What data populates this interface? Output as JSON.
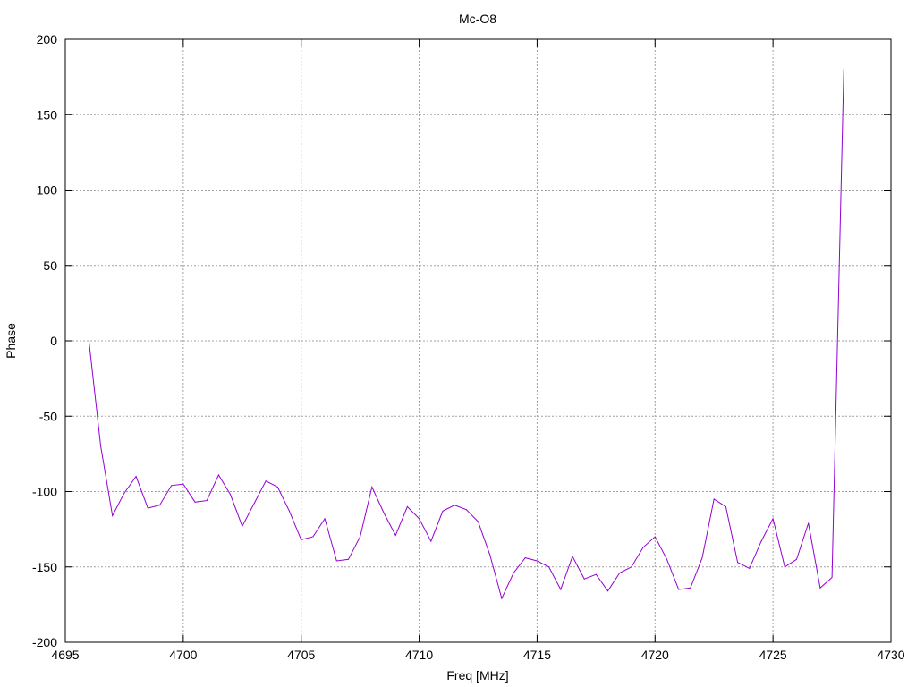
{
  "chart_data": {
    "type": "line",
    "title": "Mc-O8",
    "xlabel": "Freq [MHz]",
    "ylabel": "Phase",
    "xlim": [
      4695,
      4730
    ],
    "ylim": [
      -200,
      200
    ],
    "xticks": [
      4695,
      4700,
      4705,
      4710,
      4715,
      4720,
      4725,
      4730
    ],
    "yticks": [
      -200,
      -150,
      -100,
      -50,
      0,
      50,
      100,
      150,
      200
    ],
    "grid": true,
    "legend": "none",
    "series": [
      {
        "color": "#9400d3",
        "x": [
          4696.0,
          4696.5,
          4697.0,
          4697.5,
          4698.0,
          4698.5,
          4699.0,
          4699.5,
          4700.0,
          4700.5,
          4701.0,
          4701.5,
          4702.0,
          4702.5,
          4703.0,
          4703.5,
          4704.0,
          4704.5,
          4705.0,
          4705.5,
          4706.0,
          4706.5,
          4707.0,
          4707.5,
          4708.0,
          4708.5,
          4709.0,
          4709.5,
          4710.0,
          4710.5,
          4711.0,
          4711.5,
          4712.0,
          4712.5,
          4713.0,
          4713.5,
          4714.0,
          4714.5,
          4715.0,
          4715.5,
          4716.0,
          4716.5,
          4717.0,
          4717.5,
          4718.0,
          4718.5,
          4719.0,
          4719.5,
          4720.0,
          4720.5,
          4721.0,
          4721.5,
          4722.0,
          4722.5,
          4723.0,
          4723.5,
          4724.0,
          4724.5,
          4725.0,
          4725.5,
          4726.0,
          4726.5,
          4727.0,
          4727.5,
          4728.0
        ],
        "y": [
          0,
          -70,
          -116,
          -101,
          -90,
          -111,
          -109,
          -96,
          -95,
          -107,
          -106,
          -89,
          -102,
          -123,
          -108,
          -93,
          -97,
          -113,
          -132,
          -130,
          -118,
          -146,
          -145,
          -130,
          -97,
          -114,
          -129,
          -110,
          -118,
          -133,
          -113,
          -109,
          -112,
          -120,
          -142,
          -171,
          -154,
          -144,
          -146,
          -150,
          -165,
          -143,
          -158,
          -155,
          -166,
          -154,
          -150,
          -137,
          -130,
          -145,
          -165,
          -164,
          -144,
          -105,
          -110,
          -147,
          -151,
          -133,
          -118,
          -150,
          -145,
          -121,
          -164,
          -157,
          180
        ]
      }
    ]
  }
}
